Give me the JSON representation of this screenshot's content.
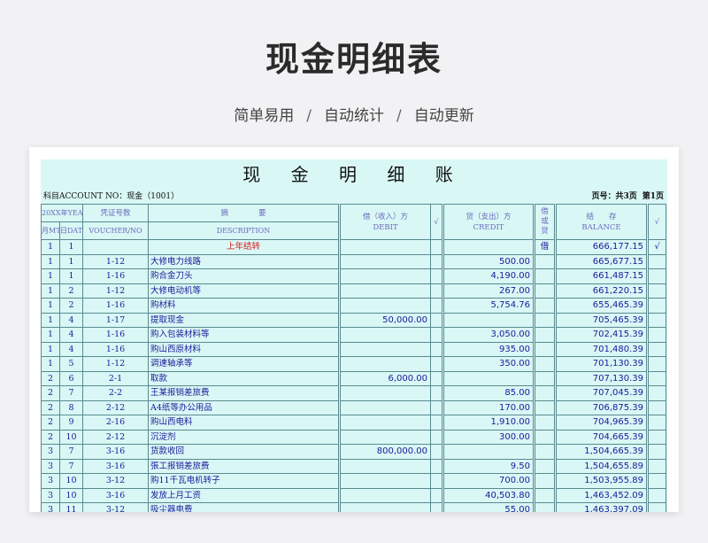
{
  "header": {
    "title": "现金明细表",
    "features": [
      "简单易用",
      "自动统计",
      "自动更新"
    ],
    "separator": "/"
  },
  "ledger": {
    "title": "现 金 明 细 账",
    "account": "科目ACCOUNT NO：现金（1001）",
    "page_label": "页号：共3页",
    "page_current": "第1页",
    "columns": {
      "year": "20XX年YEAR",
      "month": "月MTH",
      "day": "日DATE",
      "voucher": "凭证号数",
      "voucher_en": "VOUCHER/NO",
      "desc": "摘　　　　要",
      "desc_en": "DESCRIPTION",
      "debit": "借（收入）方",
      "debit_en": "DEBIT",
      "check": "√",
      "credit": "贷（支出）方",
      "credit_en": "CREDIT",
      "dc": "借或贷",
      "balance": "结　　存",
      "balance_en": "BALANCE",
      "check2": "√"
    },
    "rows": [
      {
        "m": "1",
        "d": "1",
        "v": "",
        "desc": "上年结转",
        "debit": "",
        "credit": "",
        "dc": "借",
        "balance": "666,177.15",
        "chk": "√",
        "red": true
      },
      {
        "m": "1",
        "d": "1",
        "v": "1-12",
        "desc": "大修电力线路",
        "debit": "",
        "credit": "500.00",
        "dc": "",
        "balance": "665,677.15",
        "chk": ""
      },
      {
        "m": "1",
        "d": "1",
        "v": "1-16",
        "desc": "购合金刀头",
        "debit": "",
        "credit": "4,190.00",
        "dc": "",
        "balance": "661,487.15",
        "chk": ""
      },
      {
        "m": "1",
        "d": "2",
        "v": "1-12",
        "desc": "大修电动机等",
        "debit": "",
        "credit": "267.00",
        "dc": "",
        "balance": "661,220.15",
        "chk": ""
      },
      {
        "m": "1",
        "d": "2",
        "v": "1-16",
        "desc": "购材料",
        "debit": "",
        "credit": "5,754.76",
        "dc": "",
        "balance": "655,465.39",
        "chk": ""
      },
      {
        "m": "1",
        "d": "4",
        "v": "1-17",
        "desc": "提取现金",
        "debit": "50,000.00",
        "credit": "",
        "dc": "",
        "balance": "705,465.39",
        "chk": ""
      },
      {
        "m": "1",
        "d": "4",
        "v": "1-16",
        "desc": "购入包装材料等",
        "debit": "",
        "credit": "3,050.00",
        "dc": "",
        "balance": "702,415.39",
        "chk": ""
      },
      {
        "m": "1",
        "d": "4",
        "v": "1-16",
        "desc": "购山西原材料",
        "debit": "",
        "credit": "935.00",
        "dc": "",
        "balance": "701,480.39",
        "chk": ""
      },
      {
        "m": "1",
        "d": "5",
        "v": "1-12",
        "desc": "调速轴承等",
        "debit": "",
        "credit": "350.00",
        "dc": "",
        "balance": "701,130.39",
        "chk": ""
      },
      {
        "m": "2",
        "d": "6",
        "v": "2-1",
        "desc": "取款",
        "debit": "6,000.00",
        "credit": "",
        "dc": "",
        "balance": "707,130.39",
        "chk": ""
      },
      {
        "m": "2",
        "d": "7",
        "v": "2-2",
        "desc": "王某报销差旅费",
        "debit": "",
        "credit": "85.00",
        "dc": "",
        "balance": "707,045.39",
        "chk": ""
      },
      {
        "m": "2",
        "d": "8",
        "v": "2-12",
        "desc": "A4纸等办公用品",
        "debit": "",
        "credit": "170.00",
        "dc": "",
        "balance": "706,875.39",
        "chk": ""
      },
      {
        "m": "2",
        "d": "9",
        "v": "2-16",
        "desc": "购山西电料",
        "debit": "",
        "credit": "1,910.00",
        "dc": "",
        "balance": "704,965.39",
        "chk": ""
      },
      {
        "m": "2",
        "d": "10",
        "v": "2-12",
        "desc": "沉淀剂",
        "debit": "",
        "credit": "300.00",
        "dc": "",
        "balance": "704,665.39",
        "chk": ""
      },
      {
        "m": "3",
        "d": "7",
        "v": "3-16",
        "desc": "货款收回",
        "debit": "800,000.00",
        "credit": "",
        "dc": "",
        "balance": "1,504,665.39",
        "chk": ""
      },
      {
        "m": "3",
        "d": "7",
        "v": "3-16",
        "desc": "張工报销差旅费",
        "debit": "",
        "credit": "9.50",
        "dc": "",
        "balance": "1,504,655.89",
        "chk": ""
      },
      {
        "m": "3",
        "d": "10",
        "v": "3-12",
        "desc": "购11千瓦电机转子",
        "debit": "",
        "credit": "700.00",
        "dc": "",
        "balance": "1,503,955.89",
        "chk": ""
      },
      {
        "m": "3",
        "d": "10",
        "v": "3-16",
        "desc": "发放上月工资",
        "debit": "",
        "credit": "40,503.80",
        "dc": "",
        "balance": "1,463,452.09",
        "chk": ""
      },
      {
        "m": "3",
        "d": "11",
        "v": "3-12",
        "desc": "吸尘器电费",
        "debit": "",
        "credit": "55.00",
        "dc": "",
        "balance": "1,463,397.09",
        "chk": ""
      }
    ]
  }
}
